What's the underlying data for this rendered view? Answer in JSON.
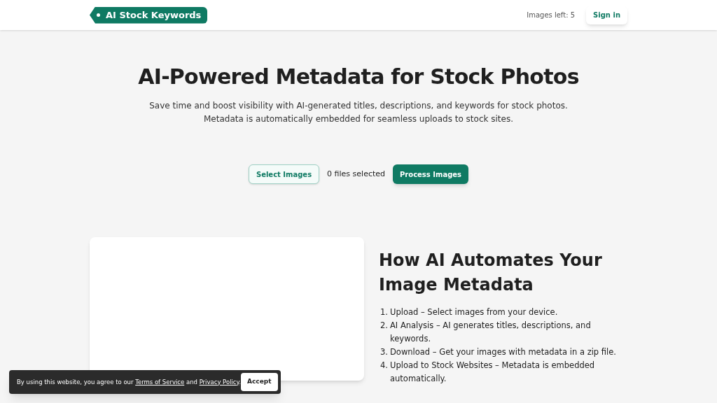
{
  "header": {
    "logo": "AI Stock Keywords",
    "images_left": "Images left: 5",
    "sign_in": "Sign in"
  },
  "hero": {
    "title": "AI-Powered Metadata for Stock Photos",
    "subtitle_lines": [
      "Save time and boost visibility with AI-generated titles, descriptions, and keywords for stock photos.",
      "Metadata is automatically embedded for seamless uploads to stock sites."
    ]
  },
  "upload": {
    "select_button": "Select Images",
    "status": "0 files selected",
    "process_button": "Process Images"
  },
  "how_it_works": {
    "title": "How AI Automates Your Image Metadata",
    "steps": [
      {
        "number": "1.",
        "text": "Upload – Select images from your device."
      },
      {
        "number": "2.",
        "text": "AI Analysis – AI generates titles, descriptions, and keywords."
      },
      {
        "number": "3.",
        "text": "Download – Get your images with metadata in a zip file."
      },
      {
        "number": "4.",
        "text": "Upload to Stock Websites – Metadata is embedded automatically."
      }
    ]
  },
  "cookie_banner": {
    "text_before": "By using this website, you agree to our ",
    "terms_link": "Terms of Service",
    "text_middle": " and ",
    "privacy_link": "Privacy Policy",
    "text_after": ".",
    "accept": "Accept"
  }
}
